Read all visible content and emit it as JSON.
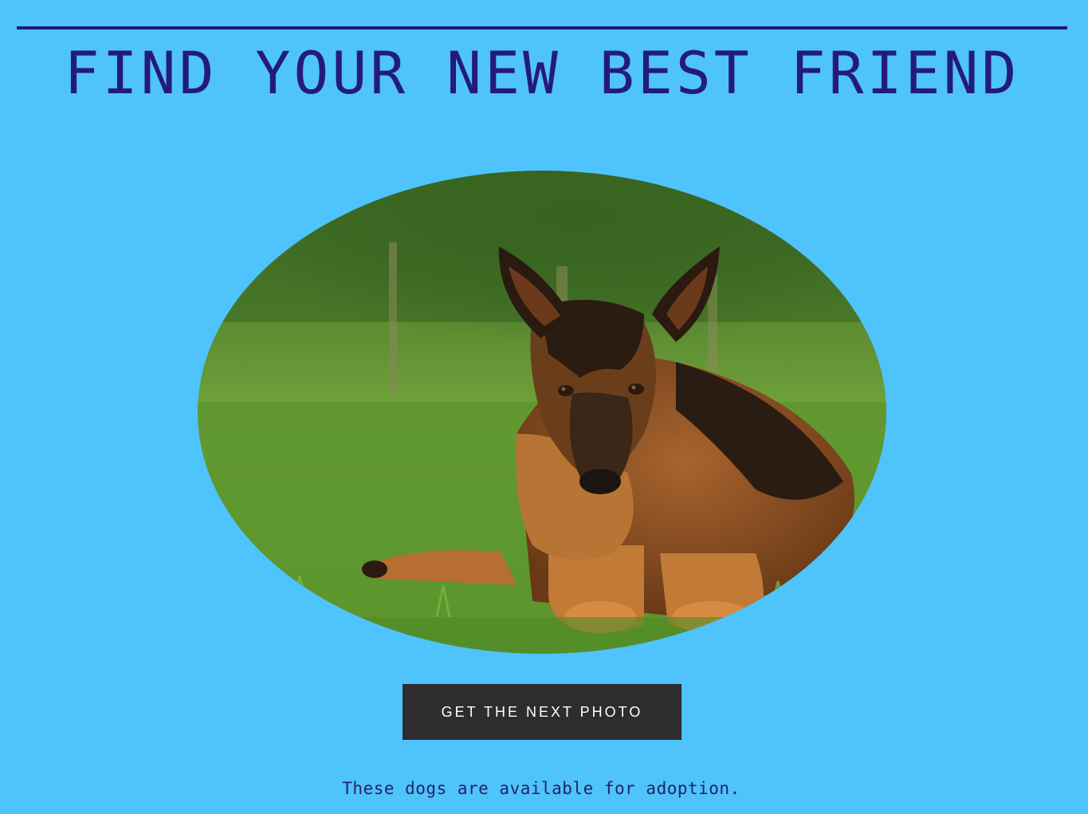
{
  "page": {
    "title": "FIND YOUR NEW BEST FRIEND",
    "photo_alt": "German Shepherd dog lying on grass",
    "button_label": "GET THE NEXT PHOTO",
    "caption": "These dogs are available for adoption."
  },
  "colors": {
    "background": "#4fc3fb",
    "title": "#241a7e",
    "rule": "#22197a",
    "button_bg": "#2e2c2e",
    "button_text": "#ffffff",
    "caption": "#232366"
  }
}
